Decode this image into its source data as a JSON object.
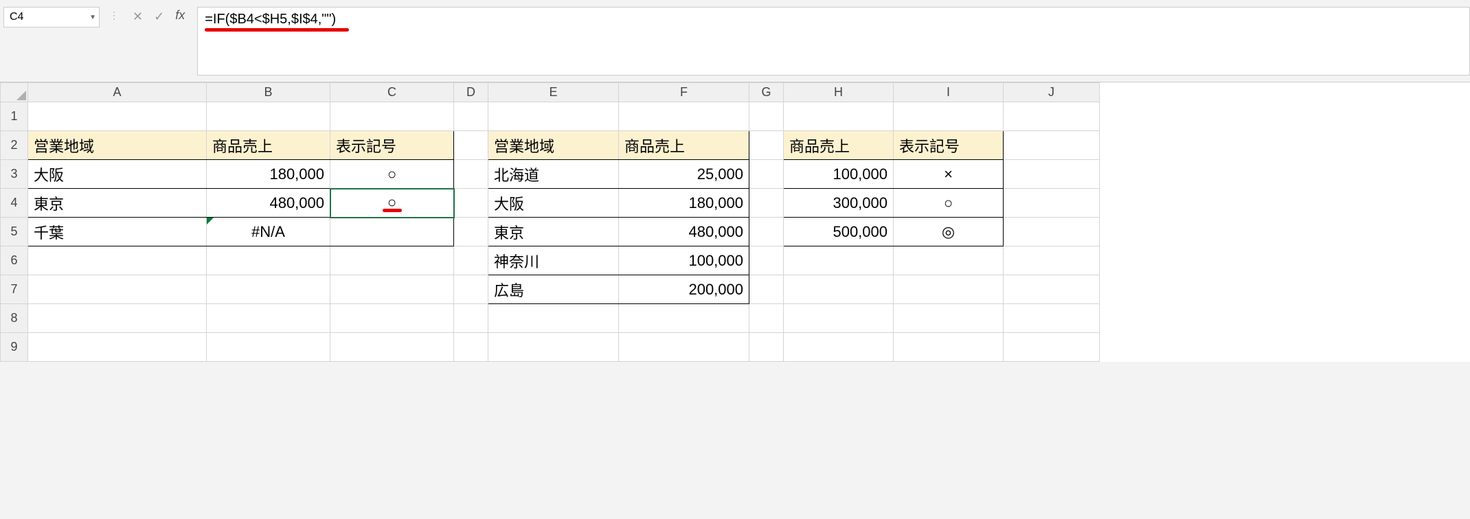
{
  "nameBox": "C4",
  "formula": "=IF($B4<$H5,$I$4,\"\")",
  "columns": [
    "A",
    "B",
    "C",
    "D",
    "E",
    "F",
    "G",
    "H",
    "I",
    "J"
  ],
  "rows": [
    "1",
    "2",
    "3",
    "4",
    "5",
    "6",
    "7",
    "8",
    "9"
  ],
  "t1": {
    "h1": "営業地域",
    "h2": "商品売上",
    "h3": "表示記号",
    "r": [
      {
        "a": "大阪",
        "b": "180,000",
        "c": "○"
      },
      {
        "a": "東京",
        "b": "480,000",
        "c": "○"
      },
      {
        "a": "千葉",
        "b": "#N/A",
        "c": ""
      }
    ]
  },
  "t2": {
    "h1": "営業地域",
    "h2": "商品売上",
    "r": [
      {
        "e": "北海道",
        "f": "25,000"
      },
      {
        "e": "大阪",
        "f": "180,000"
      },
      {
        "e": "東京",
        "f": "480,000"
      },
      {
        "e": "神奈川",
        "f": "100,000"
      },
      {
        "e": "広島",
        "f": "200,000"
      }
    ]
  },
  "t3": {
    "h1": "商品売上",
    "h2": "表示記号",
    "r": [
      {
        "h": "100,000",
        "i": "×"
      },
      {
        "h": "300,000",
        "i": "○"
      },
      {
        "h": "500,000",
        "i": "◎"
      }
    ]
  }
}
